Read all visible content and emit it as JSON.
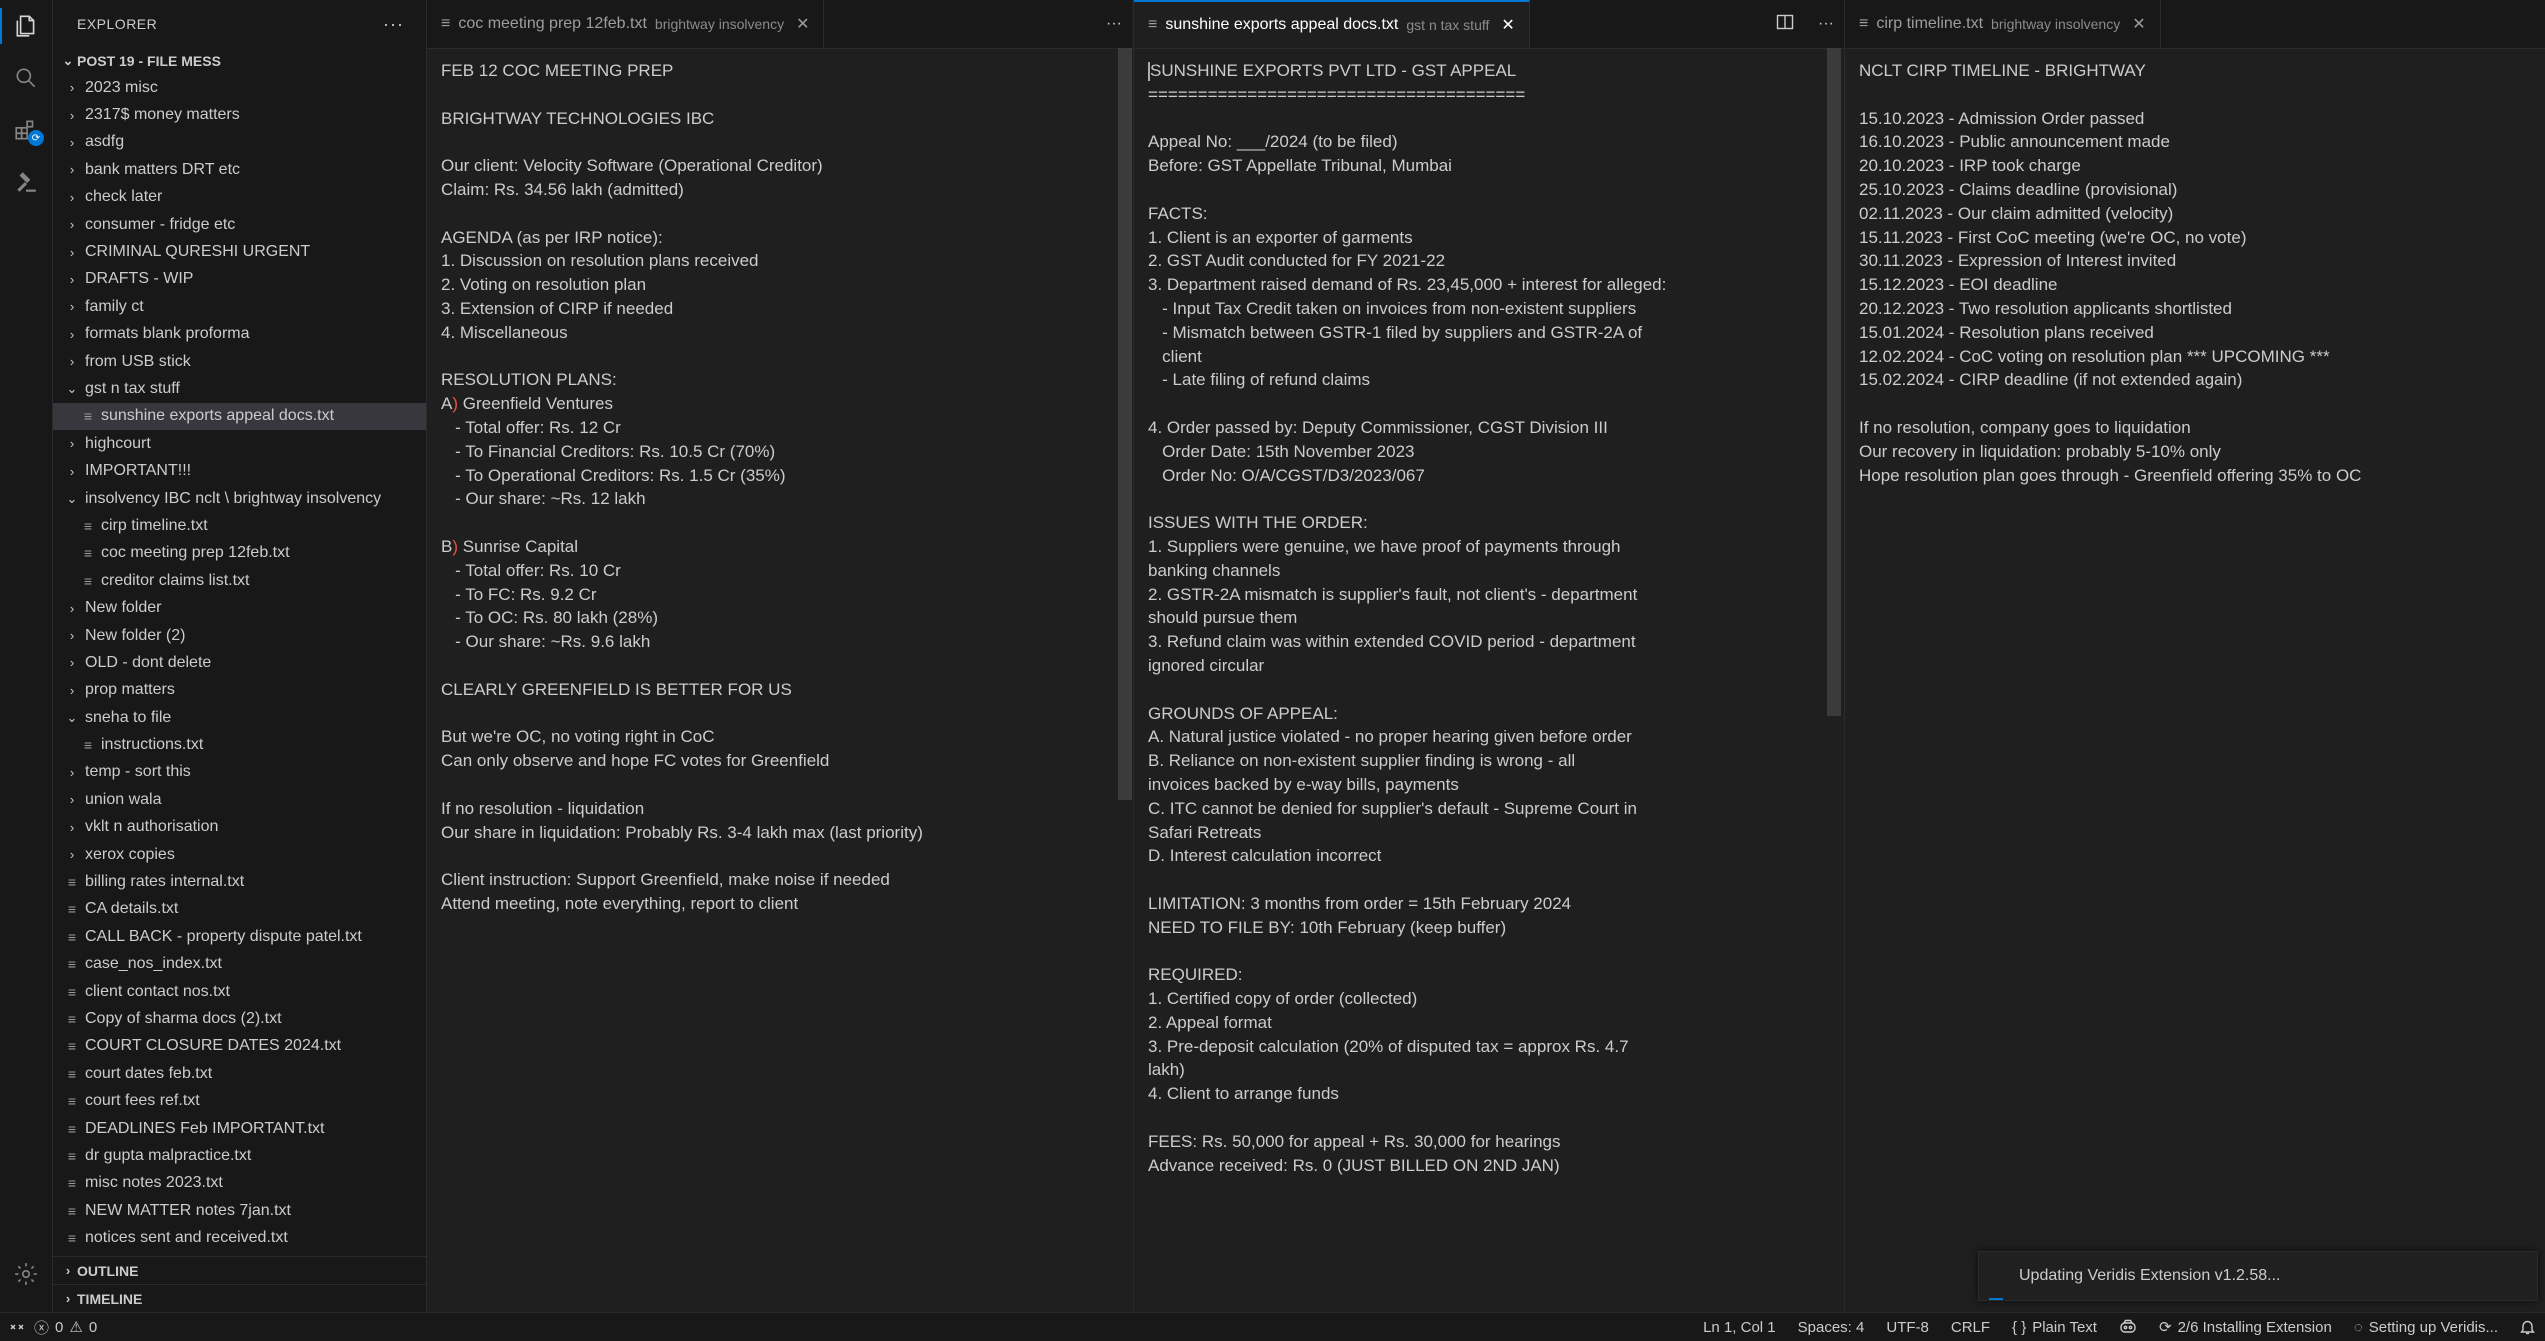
{
  "sidebar": {
    "title": "EXPLORER",
    "more": "···",
    "root": "POST 19 - FILE MESS",
    "items": [
      {
        "label": "2023 misc",
        "type": "folder",
        "depth": 1,
        "open": false
      },
      {
        "label": "2317$ money matters",
        "type": "folder",
        "depth": 1,
        "open": false
      },
      {
        "label": "asdfg",
        "type": "folder",
        "depth": 1,
        "open": false
      },
      {
        "label": "bank matters DRT etc",
        "type": "folder",
        "depth": 1,
        "open": false
      },
      {
        "label": "check later",
        "type": "folder",
        "depth": 1,
        "open": false
      },
      {
        "label": "consumer - fridge etc",
        "type": "folder",
        "depth": 1,
        "open": false
      },
      {
        "label": "CRIMINAL QURESHI URGENT",
        "type": "folder",
        "depth": 1,
        "open": false
      },
      {
        "label": "DRAFTS - WIP",
        "type": "folder",
        "depth": 1,
        "open": false
      },
      {
        "label": "family ct",
        "type": "folder",
        "depth": 1,
        "open": false
      },
      {
        "label": "formats blank proforma",
        "type": "folder",
        "depth": 1,
        "open": false
      },
      {
        "label": "from USB stick",
        "type": "folder",
        "depth": 1,
        "open": false
      },
      {
        "label": "gst n tax stuff",
        "type": "folder",
        "depth": 1,
        "open": true
      },
      {
        "label": "sunshine exports appeal docs.txt",
        "type": "file",
        "depth": 2,
        "selected": true
      },
      {
        "label": "highcourt",
        "type": "folder",
        "depth": 1,
        "open": false
      },
      {
        "label": "IMPORTANT!!!",
        "type": "folder",
        "depth": 1,
        "open": false
      },
      {
        "label": "insolvency IBC nclt \\ brightway insolvency",
        "type": "folder",
        "depth": 1,
        "open": true
      },
      {
        "label": "cirp timeline.txt",
        "type": "file",
        "depth": 2
      },
      {
        "label": "coc meeting prep 12feb.txt",
        "type": "file",
        "depth": 2
      },
      {
        "label": "creditor claims list.txt",
        "type": "file",
        "depth": 2
      },
      {
        "label": "New folder",
        "type": "folder",
        "depth": 1,
        "open": false
      },
      {
        "label": "New folder (2)",
        "type": "folder",
        "depth": 1,
        "open": false
      },
      {
        "label": "OLD - dont delete",
        "type": "folder",
        "depth": 1,
        "open": false
      },
      {
        "label": "prop matters",
        "type": "folder",
        "depth": 1,
        "open": false
      },
      {
        "label": "sneha to file",
        "type": "folder",
        "depth": 1,
        "open": true
      },
      {
        "label": "instructions.txt",
        "type": "file",
        "depth": 2
      },
      {
        "label": "temp - sort this",
        "type": "folder",
        "depth": 1,
        "open": false
      },
      {
        "label": "union wala",
        "type": "folder",
        "depth": 1,
        "open": false
      },
      {
        "label": "vklt n authorisation",
        "type": "folder",
        "depth": 1,
        "open": false
      },
      {
        "label": "xerox copies",
        "type": "folder",
        "depth": 1,
        "open": false
      },
      {
        "label": "billing rates internal.txt",
        "type": "file",
        "depth": 1
      },
      {
        "label": "CA details.txt",
        "type": "file",
        "depth": 1
      },
      {
        "label": "CALL BACK - property dispute patel.txt",
        "type": "file",
        "depth": 1
      },
      {
        "label": "case_nos_index.txt",
        "type": "file",
        "depth": 1
      },
      {
        "label": "client contact nos.txt",
        "type": "file",
        "depth": 1
      },
      {
        "label": "Copy of sharma docs (2).txt",
        "type": "file",
        "depth": 1
      },
      {
        "label": "COURT CLOSURE DATES 2024.txt",
        "type": "file",
        "depth": 1
      },
      {
        "label": "court dates feb.txt",
        "type": "file",
        "depth": 1
      },
      {
        "label": "court fees ref.txt",
        "type": "file",
        "depth": 1
      },
      {
        "label": "DEADLINES Feb IMPORTANT.txt",
        "type": "file",
        "depth": 1
      },
      {
        "label": "dr gupta malpractice.txt",
        "type": "file",
        "depth": 1
      },
      {
        "label": "misc notes 2023.txt",
        "type": "file",
        "depth": 1
      },
      {
        "label": "NEW MATTER notes 7jan.txt",
        "type": "file",
        "depth": 1
      },
      {
        "label": "notices sent and received.txt",
        "type": "file",
        "depth": 1
      }
    ],
    "sections": [
      "OUTLINE",
      "TIMELINE"
    ]
  },
  "groups": [
    {
      "tab": {
        "label": "coc meeting prep 12feb.txt",
        "desc": "brightway insolvency",
        "active": false
      },
      "more": "···",
      "lines": [
        "FEB 12 COC MEETING PREP",
        "",
        "BRIGHTWAY TECHNOLOGIES IBC",
        "",
        "Our client: Velocity Software (Operational Creditor)",
        "Claim: Rs. 34.56 lakh (admitted)",
        "",
        "AGENDA (as per IRP notice):",
        "1. Discussion on resolution plans received",
        "2. Voting on resolution plan",
        "3. Extension of CIRP if needed",
        "4. Miscellaneous",
        "",
        "RESOLUTION PLANS:",
        "A) Greenfield Ventures",
        "   - Total offer: Rs. 12 Cr",
        "   - To Financial Creditors: Rs. 10.5 Cr (70%)",
        "   - To Operational Creditors: Rs. 1.5 Cr (35%)",
        "   - Our share: ~Rs. 12 lakh",
        "",
        "B) Sunrise Capital",
        "   - Total offer: Rs. 10 Cr",
        "   - To FC: Rs. 9.2 Cr",
        "   - To OC: Rs. 80 lakh (28%)",
        "   - Our share: ~Rs. 9.6 lakh",
        "",
        "CLEARLY GREENFIELD IS BETTER FOR US",
        "",
        "But we're OC, no voting right in CoC",
        "Can only observe and hope FC votes for Greenfield",
        "",
        "If no resolution - liquidation",
        "Our share in liquidation: Probably Rs. 3-4 lakh max (last priority)",
        "",
        "Client instruction: Support Greenfield, make noise if needed",
        "Attend meeting, note everything, report to client"
      ]
    },
    {
      "tab": {
        "label": "sunshine exports appeal docs.txt",
        "desc": "gst n tax stuff",
        "active": true
      },
      "more": "···",
      "lines": [
        "SUNSHINE EXPORTS PVT LTD - GST APPEAL",
        "======================================",
        "",
        "Appeal No: ___/2024 (to be filed)",
        "Before: GST Appellate Tribunal, Mumbai",
        "",
        "FACTS:",
        "1. Client is an exporter of garments",
        "2. GST Audit conducted for FY 2021-22",
        "3. Department raised demand of Rs. 23,45,000 + interest for alleged:",
        "   - Input Tax Credit taken on invoices from non-existent suppliers",
        "   - Mismatch between GSTR-1 filed by suppliers and GSTR-2A of",
        "   client",
        "   - Late filing of refund claims",
        "",
        "4. Order passed by: Deputy Commissioner, CGST Division III",
        "   Order Date: 15th November 2023",
        "   Order No: O/A/CGST/D3/2023/067",
        "",
        "ISSUES WITH THE ORDER:",
        "1. Suppliers were genuine, we have proof of payments through",
        "banking channels",
        "2. GSTR-2A mismatch is supplier's fault, not client's - department",
        "should pursue them",
        "3. Refund claim was within extended COVID period - department",
        "ignored circular",
        "",
        "GROUNDS OF APPEAL:",
        "A. Natural justice violated - no proper hearing given before order",
        "B. Reliance on non-existent supplier finding is wrong - all",
        "invoices backed by e-way bills, payments",
        "C. ITC cannot be denied for supplier's default - Supreme Court in",
        "Safari Retreats",
        "D. Interest calculation incorrect",
        "",
        "LIMITATION: 3 months from order = 15th February 2024",
        "NEED TO FILE BY: 10th February (keep buffer)",
        "",
        "REQUIRED:",
        "1. Certified copy of order (collected)",
        "2. Appeal format",
        "3. Pre-deposit calculation (20% of disputed tax = approx Rs. 4.7",
        "lakh)",
        "4. Client to arrange funds",
        "",
        "FEES: Rs. 50,000 for appeal + Rs. 30,000 for hearings",
        "Advance received: Rs. 0 (JUST BILLED ON 2ND JAN)"
      ]
    },
    {
      "tab": {
        "label": "cirp timeline.txt",
        "desc": "brightway insolvency",
        "active": false
      },
      "more": "",
      "lines": [
        "NCLT CIRP TIMELINE - BRIGHTWAY",
        "",
        "15.10.2023 - Admission Order passed",
        "16.10.2023 - Public announcement made",
        "20.10.2023 - IRP took charge",
        "25.10.2023 - Claims deadline (provisional)",
        "02.11.2023 - Our claim admitted (velocity)",
        "15.11.2023 - First CoC meeting (we're OC, no vote)",
        "30.11.2023 - Expression of Interest invited",
        "15.12.2023 - EOI deadline",
        "20.12.2023 - Two resolution applicants shortlisted",
        "15.01.2024 - Resolution plans received",
        "12.02.2024 - CoC voting on resolution plan *** UPCOMING ***",
        "15.02.2024 - CIRP deadline (if not extended again)",
        "",
        "If no resolution, company goes to liquidation",
        "Our recovery in liquidation: probably 5-10% only",
        "Hope resolution plan goes through - Greenfield offering 35% to OC"
      ]
    }
  ],
  "notification": {
    "text": "Updating Veridis Extension v1.2.58..."
  },
  "status": {
    "errors": "0",
    "warnings": "0",
    "position": "Ln 1, Col 1",
    "spaces": "Spaces: 4",
    "encoding": "UTF-8",
    "eol": "CRLF",
    "language": "Plain Text",
    "installing": "2/6 Installing Extension",
    "setup": "Setting up Veridis..."
  }
}
